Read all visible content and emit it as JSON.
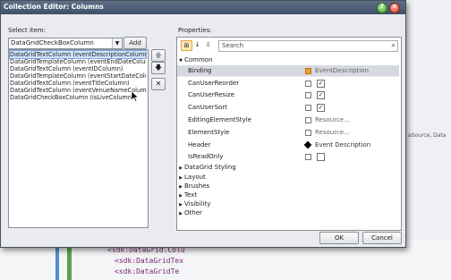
{
  "background": {
    "right_text": "aSource, Data",
    "code_lines": [
      "<sdk:DataGrid.Colu",
      "<sdk:DataGridTex",
      "<sdk:DataGridTe"
    ]
  },
  "dialog": {
    "title": "Collection Editor: Columns",
    "select_item_label": "Select item:",
    "type_combo_value": "DataGridCheckBoxColumn",
    "add_label": "Add",
    "items": [
      "DataGridTextColumn (eventDescriptionColumn)",
      "DataGridTemplateColumn (eventEndDateColumn)",
      "DataGridTextColumn (eventIDColumn)",
      "DataGridTemplateColumn (eventStartDateColumn)",
      "DataGridTextColumn (eventTitleColumn)",
      "DataGridTextColumn (eventVenueNameColumn)",
      "DataGridCheckBoxColumn (isLiveColumn)"
    ],
    "selected_index": 0,
    "move_up_icon": "arrow-up-icon",
    "move_down_icon": "arrow-down-icon",
    "remove_icon": "x-icon",
    "properties_label": "Properties:",
    "search_placeholder": "Search",
    "common_category": "Common",
    "properties": [
      {
        "name": "Binding",
        "value": "EventDescription",
        "kind": "text"
      },
      {
        "name": "CanUserReorder",
        "value": "✓",
        "kind": "check"
      },
      {
        "name": "CanUserResize",
        "value": "✓",
        "kind": "check"
      },
      {
        "name": "CanUserSort",
        "value": "✓",
        "kind": "check"
      },
      {
        "name": "EditingElementStyle",
        "value": "Resource...",
        "kind": "text"
      },
      {
        "name": "ElementStyle",
        "value": "Resource...",
        "kind": "text"
      },
      {
        "name": "Header",
        "value": "Event Description",
        "kind": "text"
      },
      {
        "name": "IsReadOnly",
        "value": "",
        "kind": "check"
      }
    ],
    "categories": [
      "DataGrid Styling",
      "Layout",
      "Brushes",
      "Text",
      "Visibility",
      "Other"
    ],
    "ok_label": "OK",
    "cancel_label": "Cancel"
  }
}
